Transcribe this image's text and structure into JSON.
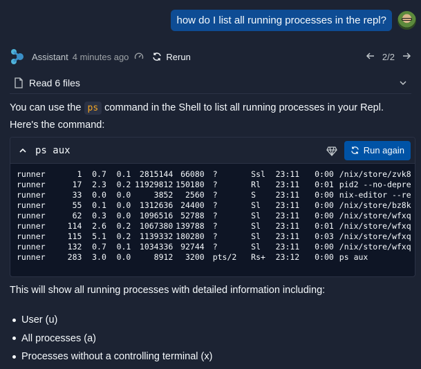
{
  "user_message": {
    "text": "how do I list all running processes in the repl?"
  },
  "assistant": {
    "name": "Assistant",
    "time": "4 minutes ago",
    "rerun_label": "Rerun",
    "pager": "2/2",
    "read_files_label": "Read 6 files"
  },
  "intro": {
    "before": "You can use the ",
    "code": "ps",
    "after": " command in the Shell to list all running processes in your Repl. Here's the command:"
  },
  "code_block": {
    "command": "ps aux",
    "run_label": "Run again",
    "rows": [
      [
        "runner",
        "1",
        "0.7",
        "0.1",
        "2815144",
        "66080",
        "?",
        "Ssl",
        "23:11",
        "0:00",
        "/nix/store/zvk8"
      ],
      [
        "runner",
        "17",
        "2.3",
        "0.2",
        "11929812",
        "150180",
        "?",
        "Rl",
        "23:11",
        "0:01",
        "pid2 --no-depre"
      ],
      [
        "runner",
        "33",
        "0.0",
        "0.0",
        "3852",
        "2560",
        "?",
        "S",
        "23:11",
        "0:00",
        "nix-editor --re"
      ],
      [
        "runner",
        "55",
        "0.1",
        "0.0",
        "1312636",
        "24400",
        "?",
        "Sl",
        "23:11",
        "0:00",
        "/nix/store/bz8k"
      ],
      [
        "runner",
        "62",
        "0.3",
        "0.0",
        "1096516",
        "52788",
        "?",
        "Sl",
        "23:11",
        "0:00",
        "/nix/store/wfxq"
      ],
      [
        "runner",
        "114",
        "2.6",
        "0.2",
        "1067380",
        "139788",
        "?",
        "Sl",
        "23:11",
        "0:01",
        "/nix/store/wfxq"
      ],
      [
        "runner",
        "115",
        "5.1",
        "0.2",
        "1139332",
        "180280",
        "?",
        "Sl",
        "23:11",
        "0:03",
        "/nix/store/wfxq"
      ],
      [
        "runner",
        "132",
        "0.7",
        "0.1",
        "1034336",
        "92744",
        "?",
        "Sl",
        "23:11",
        "0:00",
        "/nix/store/wfxq"
      ],
      [
        "runner",
        "283",
        "3.0",
        "0.0",
        "8912",
        "3200",
        "pts/2",
        "Rs+",
        "23:12",
        "0:00",
        "ps aux"
      ]
    ]
  },
  "summary": "This will show all running processes with detailed information including:",
  "bullets": [
    "User (u)",
    "All processes (a)",
    "Processes without a controlling terminal (x)"
  ],
  "colors": {
    "background": "#1c2333",
    "code_background": "#0e1525",
    "accent_blue": "#0053a6",
    "user_bubble": "#0e4c94",
    "inline_code_text": "#f5a623"
  },
  "icons": {
    "avatar": "user-avatar",
    "logo": "assistant-logo-icon",
    "speed": "gauge-icon",
    "rerun": "refresh-icon",
    "back": "arrow-left-icon",
    "forward": "arrow-right-icon",
    "file": "file-icon",
    "expand": "chevron-down-icon",
    "collapse": "chevron-up-icon",
    "gem": "gem-icon",
    "run": "refresh-icon"
  }
}
